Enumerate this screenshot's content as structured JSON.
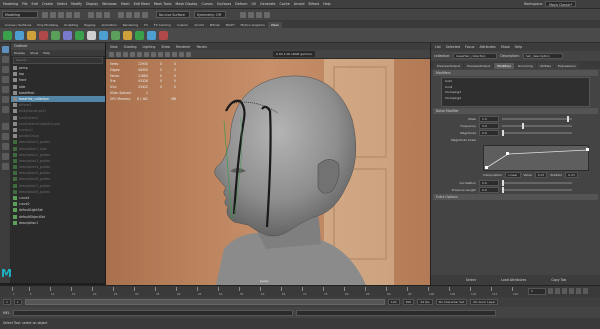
{
  "menubar": {
    "items": [
      "Modeling",
      "File",
      "Edit",
      "Create",
      "Select",
      "Modify",
      "Display",
      "Windows",
      "Mesh",
      "Edit Mesh",
      "Mesh Tools",
      "Mesh Display",
      "Curves",
      "Surfaces",
      "Deform",
      "UV",
      "Generate",
      "Cache",
      "Arnold",
      "Bifrost",
      "Help"
    ],
    "workspace_label": "Workspace:",
    "workspace_value": "Maya Classic*"
  },
  "statusline": {
    "mode": "Modeling",
    "selection_label": "No Live Surface",
    "symmetry_label": "Symmetry: Off"
  },
  "shelf_tabs": [
    {
      "label": "Curves / Surfaces",
      "active": false
    },
    {
      "label": "Poly Modeling",
      "active": false
    },
    {
      "label": "Sculpting",
      "active": false
    },
    {
      "label": "Rigging",
      "active": false
    },
    {
      "label": "Animation",
      "active": false
    },
    {
      "label": "Rendering",
      "active": false
    },
    {
      "label": "FX",
      "active": false
    },
    {
      "label": "FX Caching",
      "active": false
    },
    {
      "label": "Custom",
      "active": false
    },
    {
      "label": "Arnold",
      "active": false
    },
    {
      "label": "Bifrost",
      "active": false
    },
    {
      "label": "MASH",
      "active": false
    },
    {
      "label": "Motion Graphics",
      "active": false
    },
    {
      "label": "XGen",
      "active": true
    }
  ],
  "shelf_colors": [
    "#3aa04a",
    "#4c9fd0",
    "#d0a03a",
    "#b04a4a",
    "#5aa05a",
    "#7a7acc",
    "#3aa04a",
    "#cfcfcf",
    "#4c9fd0",
    "#5aa05a",
    "#d0a03a",
    "#3aa04a",
    "#4c9fd0",
    "#b04a4a"
  ],
  "outliner": {
    "title": "Outliner",
    "menu": [
      "Display",
      "Show",
      "Help"
    ],
    "search_placeholder": "Search...",
    "items": [
      {
        "label": "persp",
        "type": "grp",
        "sel": false,
        "dim": false
      },
      {
        "label": "top",
        "type": "grp",
        "sel": false,
        "dim": false
      },
      {
        "label": "front",
        "type": "grp",
        "sel": false,
        "dim": false
      },
      {
        "label": "side",
        "type": "grp",
        "sel": false,
        "dim": false
      },
      {
        "label": "baseMesh",
        "type": "grp",
        "sel": false,
        "dim": false
      },
      {
        "label": "baseHair_collection",
        "type": "grp",
        "sel": true,
        "dim": false
      },
      {
        "label": "pPlane1",
        "type": "grp",
        "sel": false,
        "dim": true
      },
      {
        "label": "aiSkyDomeLight1",
        "type": "grp",
        "sel": false,
        "dim": true
      },
      {
        "label": "hairSystem1",
        "type": "grp",
        "sel": false,
        "dim": true
      },
      {
        "label": "hairSystem1OutputCurves",
        "type": "grp",
        "sel": false,
        "dim": true
      },
      {
        "label": "nucleus1",
        "type": "grp",
        "sel": false,
        "dim": true
      },
      {
        "label": "guidesGroup",
        "type": "grp",
        "sel": false,
        "dim": true
      },
      {
        "label": "description1_guides",
        "type": "dis",
        "sel": false,
        "dim": true
      },
      {
        "label": "description1_tube",
        "type": "dis",
        "sel": false,
        "dim": true
      },
      {
        "label": "description2_guides",
        "type": "dis",
        "sel": false,
        "dim": true
      },
      {
        "label": "description3_guides",
        "type": "dis",
        "sel": false,
        "dim": true
      },
      {
        "label": "description4_guides",
        "type": "dis",
        "sel": false,
        "dim": true
      },
      {
        "label": "description5_guides",
        "type": "dis",
        "sel": false,
        "dim": true
      },
      {
        "label": "description6_guides",
        "type": "dis",
        "sel": false,
        "dim": true
      },
      {
        "label": "description7_guides",
        "type": "dis",
        "sel": false,
        "dim": true
      },
      {
        "label": "description8_guides",
        "type": "dis",
        "sel": false,
        "dim": true
      },
      {
        "label": "curve1",
        "type": "crv",
        "sel": false,
        "dim": false
      },
      {
        "label": "curve2",
        "type": "crv",
        "sel": false,
        "dim": false
      },
      {
        "label": "defaultLightSet",
        "type": "crv",
        "sel": false,
        "dim": false
      },
      {
        "label": "defaultObjectSet",
        "type": "crv",
        "sel": false,
        "dim": false
      },
      {
        "label": "description1",
        "type": "crv",
        "sel": false,
        "dim": false
      }
    ]
  },
  "viewport": {
    "menu": [
      "View",
      "Shading",
      "Lighting",
      "Show",
      "Renderer",
      "Panels"
    ],
    "camera_field": "0.00  1.00  sRGB gamma",
    "camera_name": "persp",
    "hud": [
      {
        "k": "Verts:",
        "v1": "22950",
        "v2": "0",
        "v3": "0"
      },
      {
        "k": "Edges:",
        "v1": "44550",
        "v2": "0",
        "v3": "0"
      },
      {
        "k": "Faces:",
        "v1": "21664",
        "v2": "0",
        "v3": "0"
      },
      {
        "k": "Tris:",
        "v1": "43328",
        "v2": "0",
        "v3": "0"
      },
      {
        "k": "UVs:",
        "v1": "23432",
        "v2": "0",
        "v3": "0"
      },
      {
        "k": "XGen Splines:",
        "v1": "2",
        "v2": "",
        "v3": ""
      },
      {
        "k": "GPU Memory:",
        "v1": "8 / 182",
        "v2": "",
        "v3": "MB"
      }
    ]
  },
  "attribute_editor": {
    "menu": [
      "List",
      "Selected",
      "Focus",
      "Attributes",
      "Show",
      "Help"
    ],
    "node_label": "collection:",
    "node_value": "baseHair_collection",
    "desc_label": "Description:",
    "desc_value": "hair_description",
    "tabs": [
      {
        "label": "Preview/Output",
        "active": false
      },
      {
        "label": "Preview/Output",
        "active": false
      },
      {
        "label": "Modifiers",
        "active": true
      },
      {
        "label": "Grooming",
        "active": false
      },
      {
        "label": "Utilities",
        "active": false
      },
      {
        "label": "Expressions",
        "active": false
      }
    ],
    "modifier_section": "Modifiers",
    "modifier_list": [
      "Cut1",
      "Coil1",
      "Clumping1",
      "Clumping2"
    ],
    "noise_section": "Noise Modifier",
    "attrs": [
      {
        "label": "Mask",
        "value": "1.0",
        "knob": 0.95
      },
      {
        "label": "Frequency",
        "value": "3.0",
        "knob": 0.3
      },
      {
        "label": "Magnitude",
        "value": "0.0",
        "knob": 0.0
      },
      {
        "label": "Magnitude Scale",
        "value": "",
        "knob": -1
      }
    ],
    "ramp": {
      "interp_label": "Interpolation",
      "interp_value": "Linear",
      "value_label": "Value",
      "value": "0.07",
      "pos_label": "Position",
      "pos_value": "0.23"
    },
    "attrs2": [
      {
        "label": "Correlation",
        "value": "0.0",
        "knob": 0.0
      },
      {
        "label": "Preserve Length",
        "value": "0.0",
        "knob": 0.0
      }
    ],
    "extra_section": "Extra Options",
    "bottom": [
      "Select",
      "Load Attributes",
      "Copy Tab"
    ]
  },
  "timeslider": {
    "labels": [
      "1",
      "5",
      "10",
      "15",
      "20",
      "25",
      "30",
      "35",
      "40",
      "45",
      "50",
      "55",
      "60",
      "65",
      "70",
      "75",
      "80",
      "85",
      "90",
      "95",
      "100",
      "105",
      "110",
      "115",
      "120"
    ],
    "current": "1"
  },
  "rangeslider": {
    "start": "1",
    "start2": "1",
    "end": "120",
    "end2": "200",
    "charset": "No Character Set",
    "animlayer": "No Anim Layer",
    "fps": "24 fps"
  },
  "cmdline": {
    "label": "MEL",
    "value": ""
  },
  "helpline": {
    "text": "Select Tool: select an object"
  }
}
